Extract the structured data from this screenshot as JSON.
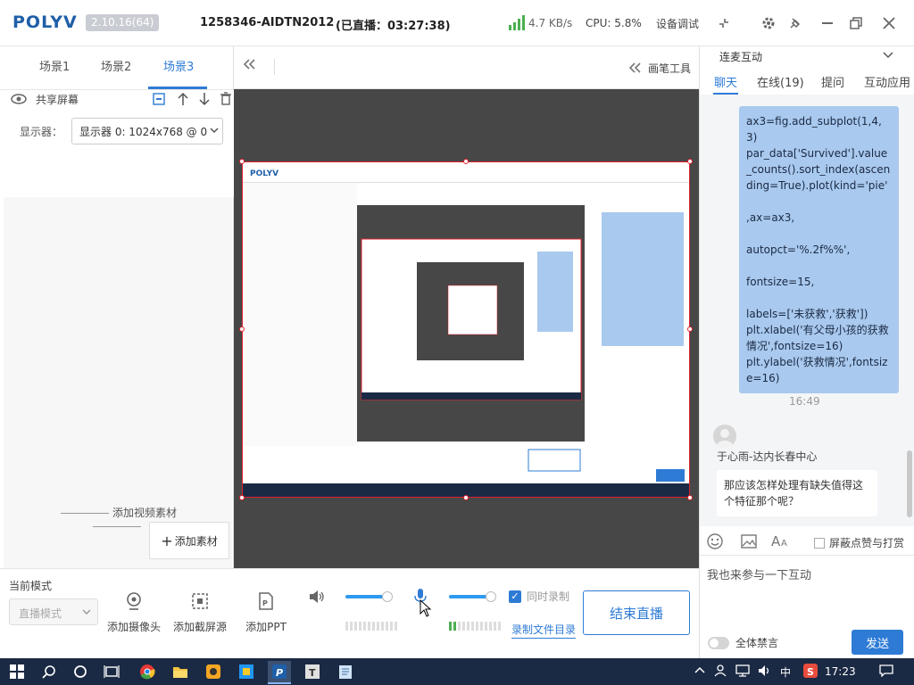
{
  "titlebar": {
    "logo": "POLYV",
    "version": "2.10.16(64)",
    "room": "1258346-AIDTN2012",
    "live_status": "(已直播：03:27:38)",
    "speed": "4.7 KB/s",
    "cpu": "CPU: 5.8%",
    "device_debug": "设备调试"
  },
  "scenes": {
    "tabs": [
      "场景1",
      "场景2",
      "场景3"
    ],
    "active": "场景3",
    "source_name": "共享屏幕",
    "display_label": "显示器：",
    "display_value": "显示器 0: 1024x768 @ 0",
    "add_video_label": "添加视频素材",
    "add_material": "添加素材"
  },
  "preview": {
    "draw_tools": "画笔工具"
  },
  "controls": {
    "current_mode_label": "当前模式",
    "mode_placeholder": "直播模式",
    "add_camera": "添加摄像头",
    "add_capture": "添加截屏源",
    "add_ppt": "添加PPT",
    "sync_record": "同时录制",
    "record_dir": "录制文件目录",
    "end_live": "结束直播",
    "speaker_volume": 0.9,
    "mic_volume": 0.9
  },
  "right_panel": {
    "title": "连麦互动",
    "tabs": [
      "聊天",
      "在线(19)",
      "提问",
      "互动应用"
    ],
    "active_tab": "聊天",
    "code_message": "ax3=fig.add_subplot(1,4,3)\npar_data['Survived'].value_counts().sort_index(ascending=True).plot(kind='pie'\n\n,ax=ax3,\n\nautopct='%.2f%%',\n\nfontsize=15,\n\nlabels=['未获救','获救'])\nplt.xlabel('有父母小孩的获救情况',fontsize=16)\nplt.ylabel('获救情况',fontsize=16)",
    "time": "16:49",
    "user_name": "于心雨-达内长春中心",
    "user_message": "那应该怎样处理有缺失值得这个特征那个呢？",
    "ban_praise": "屏蔽点赞与打赏",
    "input_text": "我也来参与一下互动",
    "mute_all": "全体禁言",
    "send": "发送"
  },
  "taskbar": {
    "ime": "中",
    "clock": "17:23"
  }
}
